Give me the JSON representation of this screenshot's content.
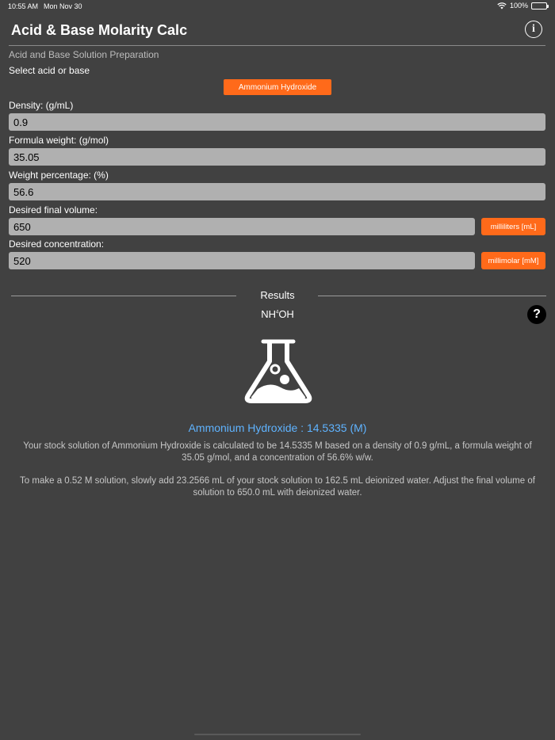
{
  "status_bar": {
    "time": "10:55 AM",
    "date": "Mon Nov 30",
    "battery_text": "100%"
  },
  "header": {
    "title": "Acid & Base Molarity Calc",
    "info_icon": "info-circle-icon"
  },
  "form": {
    "section_title": "Acid and Base Solution Preparation",
    "select_label": "Select acid or base",
    "selected_compound": "Ammonium Hydroxide",
    "density_label": "Density:  (g/mL)",
    "density_value": "0.9",
    "formula_weight_label": "Formula weight:  (g/mol)",
    "formula_weight_value": "35.05",
    "weight_percentage_label": "Weight percentage:  (%)",
    "weight_percentage_value": "56.6",
    "final_volume_label": "Desired final volume:",
    "final_volume_value": "650",
    "volume_unit": "milliliters [mL]",
    "concentration_label": "Desired concentration:",
    "concentration_value": "520",
    "concentration_unit": "millimolar [mM]"
  },
  "results": {
    "title": "Results",
    "formula_main": "NH",
    "formula_sub": "4",
    "formula_end": "OH",
    "help_label": "?",
    "molarity_line": "Ammonium Hydroxide : 14.5335 (M)",
    "stock_description": "Your stock solution of Ammonium Hydroxide is calculated to be 14.5335 M based on a density of 0.9 g/mL, a formula weight of 35.05 g/mol, and a concentration of 56.6% w/w.",
    "instruction": "To make a 0.52 M solution, slowly add 23.2566 mL of your stock solution to 162.5 mL deionized water. Adjust the final volume of solution to 650.0 mL with deionized water."
  },
  "colors": {
    "background": "#414141",
    "accent": "#ff6a1a",
    "result_value": "#5fb3ff",
    "input_bg": "#b0b0b0"
  }
}
